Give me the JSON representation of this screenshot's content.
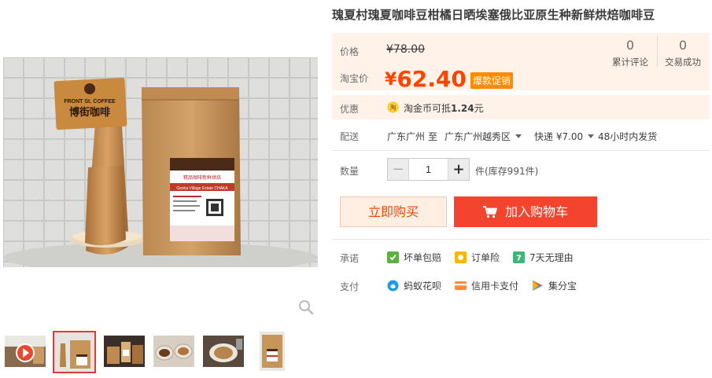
{
  "product": {
    "title": "瑰夏村瑰夏咖啡豆柑橘日晒埃塞俄比亚原生种新鲜烘焙咖啡豆"
  },
  "gallery": {
    "main_image_name": "coffee-bag-with-wooden-sign",
    "sign_text_en": "FRONT St. COFFEE",
    "sign_text_cn": "博街咖啡",
    "bag_label_cn": "精品咖啡新鲜烘焙",
    "bag_label_en": "Gesha Village Estate CHAKA",
    "thumbnails": [
      "video-thumb",
      "bag-thumb",
      "packages-thumb",
      "beans-thumb",
      "brewing-thumb",
      "bag-front-thumb"
    ],
    "active_thumbnail": 1
  },
  "price": {
    "original_label": "价格",
    "original_value": "¥78.00",
    "current_label": "淘宝价",
    "currency": "¥",
    "current_value": "62.40",
    "promo_badge": "爆款促销"
  },
  "stats": {
    "reviews_count": "0",
    "reviews_label": "累计评论",
    "sales_count": "0",
    "sales_label": "交易成功"
  },
  "coupon": {
    "label": "优惠",
    "icon": "tao-coin-icon",
    "text_prefix": "淘金币可抵",
    "text_amount": "1.24",
    "text_suffix": "元"
  },
  "shipping": {
    "label": "配送",
    "from": "广东广州",
    "to_word": "至",
    "to": "广东广州越秀区",
    "method": "快递 ¥7.00",
    "dispatch": "48小时内发货"
  },
  "quantity": {
    "label": "数量",
    "value": "1",
    "minus": "−",
    "plus": "+",
    "stock": "件(库存991件)"
  },
  "actions": {
    "buy_now": "立即购买",
    "add_cart": "加入购物车"
  },
  "promises": {
    "label": "承诺",
    "items": [
      "坏单包赔",
      "订单险",
      "7天无理由"
    ]
  },
  "payment": {
    "label": "支付",
    "items": [
      "蚂蚁花呗",
      "信用卡支付",
      "集分宝"
    ]
  },
  "colors": {
    "accent": "#ff4400",
    "cart_button": "#f4442e",
    "price_bg": "#fff2e8",
    "badge": "#ff8a00"
  }
}
